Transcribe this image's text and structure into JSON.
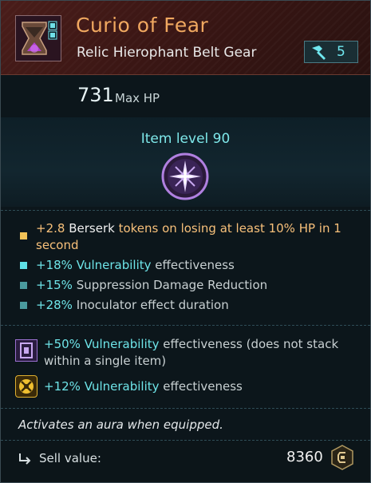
{
  "item": {
    "name": "Curio of Fear",
    "type": "Relic Hierophant Belt Gear",
    "level_badge": "5"
  },
  "stats": {
    "hp_value": "731",
    "hp_label": "Max HP"
  },
  "item_level": "Item level 90",
  "modifiers": [
    {
      "value": "+2.8",
      "keyword": "Berserk",
      "text_line1": "tokens on losing at least 10% HP in 1",
      "text_line2": "second",
      "bullet_color": "#f2c257"
    },
    {
      "value": "+18%",
      "keyword": "Vulnerability",
      "text": "effectiveness",
      "bullet_color": "#5fe0e6"
    },
    {
      "value": "+15%",
      "text": "Suppression Damage Reduction",
      "bullet_color": "#4a9a9e"
    },
    {
      "value": "+28%",
      "text": "Inoculator effect duration",
      "bullet_color": "#4a9a9e"
    }
  ],
  "blessings": [
    {
      "value": "+50%",
      "keyword": "Vulnerability",
      "text_line1": "effectiveness (does not stack",
      "text_line2": "within a single item)",
      "icon": "purple-rune-icon"
    },
    {
      "value": "+12%",
      "keyword": "Vulnerability",
      "text": "effectiveness",
      "icon": "gold-rune-icon"
    }
  ],
  "aura_text": "Activates an aura when equipped.",
  "sell": {
    "label": "Sell value:",
    "value": "8360",
    "icon": "credit-coin-icon"
  },
  "colors": {
    "name": "#f0a860",
    "accent_cyan": "#6ee4e8",
    "accent_gold": "#f7c07a"
  }
}
